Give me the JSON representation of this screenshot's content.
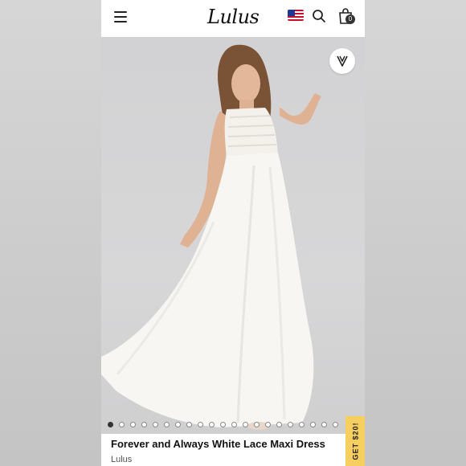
{
  "header": {
    "logo_text": "Lulus",
    "cart_count": "0",
    "icons": [
      "hamburger-menu-icon",
      "us-flag-icon",
      "search-icon",
      "shopping-bag-icon"
    ]
  },
  "gallery": {
    "image_count": 21,
    "active_index": 0,
    "wishlist_icon": "heart-v-icon"
  },
  "product": {
    "title": "Forever and Always White Lace Maxi Dress",
    "brand": "Lulus"
  },
  "promo": {
    "label": "GET $20!",
    "color": "#f7cf60"
  }
}
